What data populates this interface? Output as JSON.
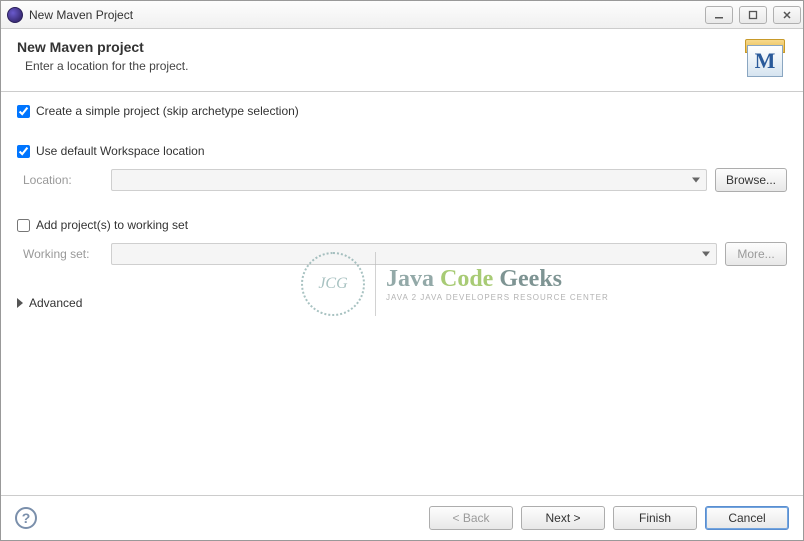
{
  "window": {
    "title": "New Maven Project"
  },
  "header": {
    "title": "New Maven project",
    "subtitle": "Enter a location for the project.",
    "icon_letter": "M"
  },
  "checks": {
    "simple_project": {
      "label": "Create a simple project (skip archetype selection)",
      "checked": true
    },
    "default_workspace": {
      "label": "Use default Workspace location",
      "checked": true
    },
    "add_working_set": {
      "label": "Add project(s) to working set",
      "checked": false
    }
  },
  "fields": {
    "location": {
      "label": "Location:",
      "value": ""
    },
    "working_set": {
      "label": "Working set:",
      "value": ""
    }
  },
  "buttons": {
    "browse": "Browse...",
    "more": "More...",
    "advanced": "Advanced",
    "back": "< Back",
    "next": "Next >",
    "finish": "Finish",
    "cancel": "Cancel"
  },
  "watermark": {
    "badge": "JCG",
    "word1": "Java",
    "word2": "Code",
    "word3": "Geeks",
    "subtitle": "JAVA 2 JAVA DEVELOPERS RESOURCE CENTER"
  }
}
